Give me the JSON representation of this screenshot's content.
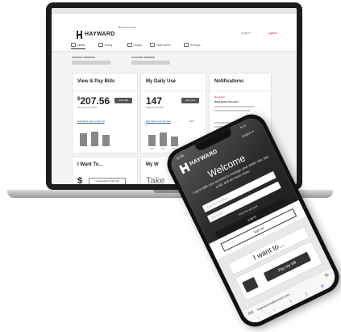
{
  "laptop": {
    "header": {
      "logo_text": "HAYWARD",
      "welcome": "Welcome back",
      "language": "English",
      "logout": "Logout"
    },
    "nav": [
      {
        "label": "Home",
        "icon": "home-icon",
        "active": true
      },
      {
        "label": "Billing",
        "icon": "bill-icon",
        "active": false
      },
      {
        "label": "Usage",
        "icon": "chart-icon",
        "active": false
      },
      {
        "label": "Take Action",
        "icon": "action-icon",
        "active": false
      },
      {
        "label": "Settings",
        "icon": "gear-icon",
        "active": false
      }
    ],
    "account": {
      "service_label": "SERVICE ADDRESS",
      "account_label": "ACCOUNT NUMBER"
    },
    "cards": {
      "bills": {
        "title": "View & Pay Bills",
        "amount_symbol": "$",
        "amount": "207.56",
        "due": "Due Aug 24, 2022",
        "button": "View Bill",
        "link": "Estimated next month bill"
      },
      "usage": {
        "title": "My Daily Use",
        "value": "147",
        "unit": "Gallons Per Day",
        "button": "View use",
        "link": "Estimated next bill date",
        "change": "10%"
      },
      "notifications": {
        "title": "Notifications",
        "badge": "Reminder",
        "heading": "Want Better Results?"
      },
      "iwant": {
        "title": "I Want To...",
        "option": "Understand a high bill"
      },
      "more": {
        "title": "My W",
        "body": "Take"
      }
    },
    "usage_chart": {
      "categories": [
        "June",
        "July",
        "Aug"
      ],
      "values": [
        0.7,
        0.85,
        0.6
      ]
    }
  },
  "phone": {
    "status_time": "11:38",
    "logo_text": "HAYWARD",
    "language": "English",
    "welcome": "Welcome",
    "subtitle": "Log in with your account to manage your water use, pay a bill, and do much more.",
    "username_placeholder": "Account number",
    "password_placeholder": "Zip code",
    "forgot": "Find my account",
    "login": "Log in",
    "signup": "Sign up",
    "iwant_title": "I want to...",
    "pay_button": "Pay my bill",
    "url_aa": "AA",
    "url": "hayward.watersmart.com"
  }
}
